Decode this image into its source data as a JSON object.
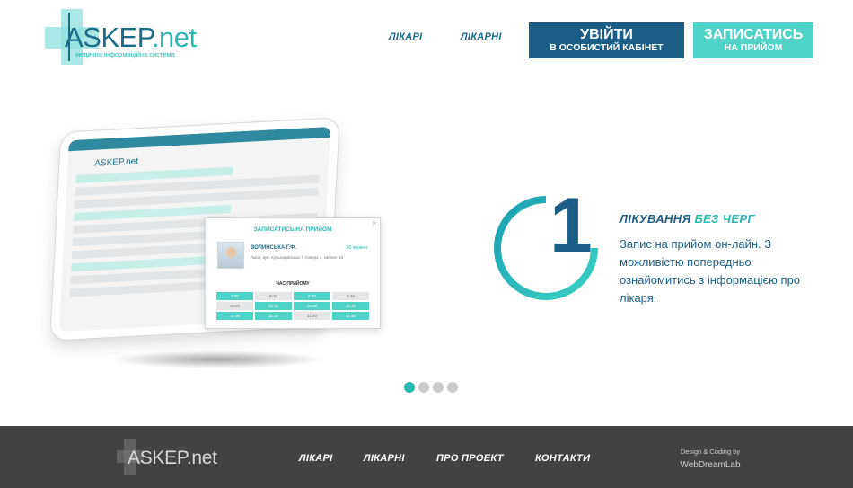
{
  "header": {
    "logo": {
      "brand": "ASKEP",
      "brand_suffix": ".net",
      "tagline": "медична інформаційна система"
    },
    "nav": [
      {
        "label": "ЛІКАРІ"
      },
      {
        "label": "ЛІКАРНІ"
      }
    ],
    "login_button": {
      "line1": "УВІЙТИ",
      "line2": "В ОСОБИСТИЙ КАБІНЕТ"
    },
    "book_button": {
      "line1": "ЗАПИСАТИСЬ",
      "line2": "НА ПРИЙОМ"
    }
  },
  "hero": {
    "tablet": {
      "mini_logo": "ASKEP.net",
      "popup": {
        "title": "ЗАПИСАТИСЬ НА ПРИЙОМ",
        "doctor": "ВОЛИНСЬКА Г.Ф.",
        "date": "30 червня",
        "address": "Львів, вул. Кульпарківська 7, поверх 1, кабінет 16",
        "slots_label": "ЧАС ПРИЙОМУ",
        "slots": [
          {
            "time": "9:00",
            "available": true
          },
          {
            "time": "9:15",
            "available": false
          },
          {
            "time": "9:30",
            "available": true
          },
          {
            "time": "9:45",
            "available": false
          },
          {
            "time": "10:00",
            "available": false
          },
          {
            "time": "10:15",
            "available": true
          },
          {
            "time": "10:30",
            "available": true
          },
          {
            "time": "10:45",
            "available": true
          },
          {
            "time": "11:00",
            "available": true
          },
          {
            "time": "11:15",
            "available": true
          },
          {
            "time": "11:30",
            "available": false
          },
          {
            "time": "11:45",
            "available": true
          }
        ]
      }
    },
    "step_number": "1",
    "title_main": "ЛІКУВАННЯ",
    "title_accent": "БЕЗ ЧЕРГ",
    "text": "Запис на прийом он-лайн. З можливістю попередньо ознайомитись з інформацією про лікаря.",
    "slides": [
      {
        "active": true
      },
      {
        "active": false
      },
      {
        "active": false
      },
      {
        "active": false
      }
    ]
  },
  "footer": {
    "logo": "ASKEP.net",
    "links": [
      {
        "label": "ЛІКАРІ"
      },
      {
        "label": "ЛІКАРНІ"
      },
      {
        "label": "ПРО ПРОЕКТ"
      },
      {
        "label": "КОНТАКТИ"
      }
    ],
    "credit_line1": "Design & Coding by",
    "credit_line2": "WebDreamLab"
  },
  "colors": {
    "primary": "#1b5e85",
    "accent": "#29b7b0",
    "button_accent": "#4fd2c7",
    "footer": "#424242"
  }
}
